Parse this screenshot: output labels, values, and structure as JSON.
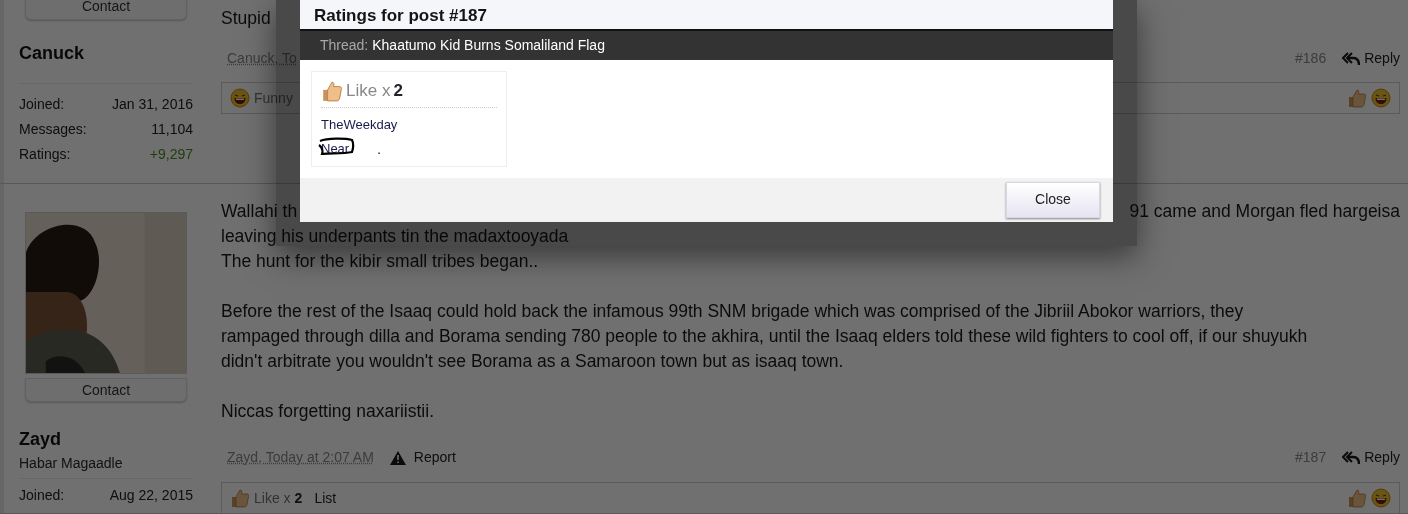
{
  "posts": [
    {
      "author": {
        "contact": "Contact",
        "name": "Canuck",
        "stats": [
          {
            "label": "Joined:",
            "value": "Jan 31, 2016",
            "kind": "plain"
          },
          {
            "label": "Messages:",
            "value": "11,104",
            "kind": "plain"
          },
          {
            "label": "Ratings:",
            "value": "+9,297",
            "kind": "positive"
          }
        ]
      },
      "body": [
        [
          "Stupid"
        ]
      ],
      "meta": {
        "byline": "Canuck, To",
        "number": "#186",
        "reply": "Reply"
      },
      "ratings": {
        "items": [
          {
            "kind": "funny",
            "label": "Funny"
          }
        ]
      }
    },
    {
      "author": {
        "contact": "Contact",
        "name": "Zayd",
        "title": "Habar Magaadle",
        "stats": [
          {
            "label": "Joined:",
            "value": "Aug 22, 2015",
            "kind": "plain"
          }
        ]
      },
      "body": [
        [
          "Wallahi th",
          "91 came and Morgan fled hargeisa",
          "leaving his underpants tin the madaxtooyada",
          "The hunt for the kibir small tribes began.."
        ],
        [
          "Before the rest of the Isaaq could hold back the infamous 99th SNM brigade which was comprised of the Jibriil Abokor warriors, they",
          "rampaged through dilla and Borama sending 780 people to the akhira, until the Isaaq elders told these wild fighters to cool off, if our shuyukh",
          "didn't arbitrate you wouldn't see Borama as a Samaroon town but as isaaq town."
        ],
        [
          "Niccas forgetting naxariistii."
        ]
      ],
      "meta": {
        "byline": "Zayd, Today at 2:07 AM",
        "report": "Report",
        "number": "#187",
        "reply": "Reply"
      },
      "ratings": {
        "items": [
          {
            "kind": "like",
            "label": "Like x",
            "count": "2"
          }
        ],
        "list": "List"
      }
    }
  ],
  "modal": {
    "title": "Ratings for post #187",
    "thread_label": "Thread:",
    "thread_title": "Khaatumo Kid Burns Somaliland Flag",
    "ratings": [
      {
        "kind": "like",
        "label": "Like x",
        "count": "2",
        "users": [
          {
            "name": "TheWeekday",
            "circled": false
          },
          {
            "name": "Near",
            "circled": true
          }
        ],
        "note": "."
      }
    ],
    "close": "Close"
  }
}
